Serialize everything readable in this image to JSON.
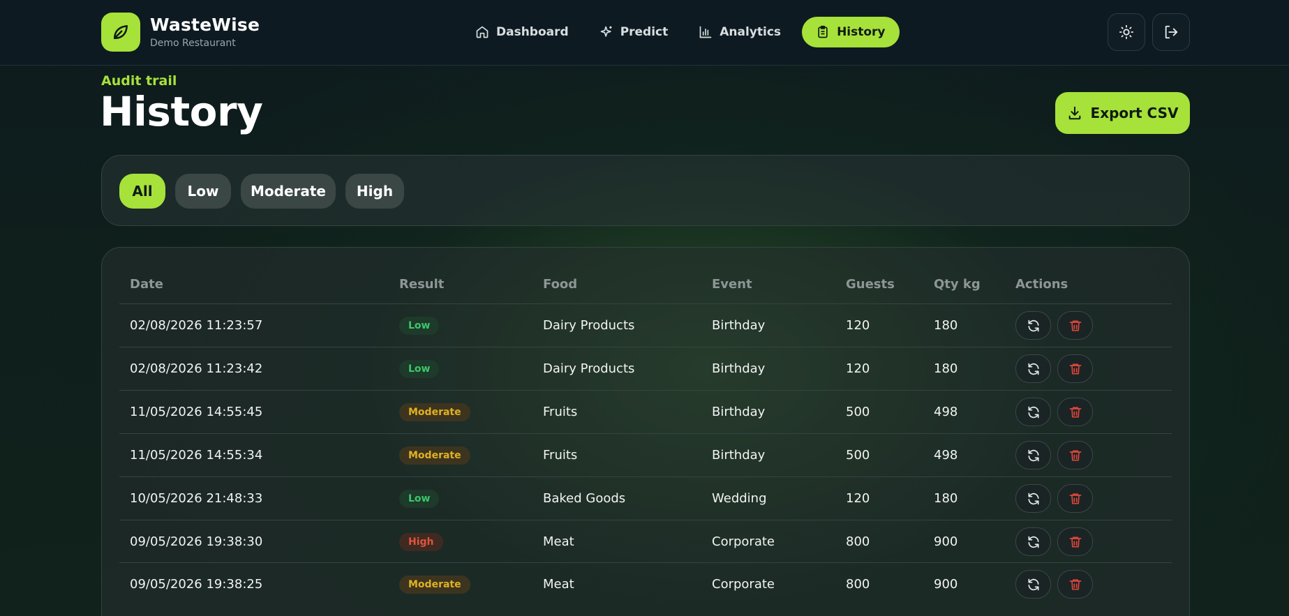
{
  "brand": {
    "name": "WasteWise",
    "subtitle": "Demo Restaurant"
  },
  "nav": {
    "items": [
      {
        "label": "Dashboard",
        "icon": "home-icon"
      },
      {
        "label": "Predict",
        "icon": "sparkle-icon"
      },
      {
        "label": "Analytics",
        "icon": "bar-chart-icon"
      },
      {
        "label": "History",
        "icon": "clipboard-icon",
        "active": true
      }
    ],
    "theme_toggle_icon": "sun-icon",
    "logout_icon": "logout-icon"
  },
  "header": {
    "eyebrow": "Audit trail",
    "title": "History",
    "export_label": "Export CSV"
  },
  "filters": {
    "chips": [
      "All",
      "Low",
      "Moderate",
      "High"
    ],
    "active": "All"
  },
  "table": {
    "columns": [
      "Date",
      "Result",
      "Food",
      "Event",
      "Guests",
      "Qty kg",
      "Actions"
    ],
    "rows": [
      {
        "date": "02/08/2026 11:23:57",
        "result": "Low",
        "food": "Dairy Products",
        "event": "Birthday",
        "guests": "120",
        "qty": "180"
      },
      {
        "date": "02/08/2026 11:23:42",
        "result": "Low",
        "food": "Dairy Products",
        "event": "Birthday",
        "guests": "120",
        "qty": "180"
      },
      {
        "date": "11/05/2026 14:55:45",
        "result": "Moderate",
        "food": "Fruits",
        "event": "Birthday",
        "guests": "500",
        "qty": "498"
      },
      {
        "date": "11/05/2026 14:55:34",
        "result": "Moderate",
        "food": "Fruits",
        "event": "Birthday",
        "guests": "500",
        "qty": "498"
      },
      {
        "date": "10/05/2026 21:48:33",
        "result": "Low",
        "food": "Baked Goods",
        "event": "Wedding",
        "guests": "120",
        "qty": "180"
      },
      {
        "date": "09/05/2026 19:38:30",
        "result": "High",
        "food": "Meat",
        "event": "Corporate",
        "guests": "800",
        "qty": "900"
      },
      {
        "date": "09/05/2026 19:38:25",
        "result": "Moderate",
        "food": "Meat",
        "event": "Corporate",
        "guests": "800",
        "qty": "900"
      }
    ],
    "row_actions": [
      "refresh-icon",
      "trash-icon"
    ]
  },
  "colors": {
    "accent": "#a6e23a",
    "low": "#3cc86a",
    "moderate": "#e0b220",
    "high": "#e2533c",
    "danger": "#e0463a"
  }
}
